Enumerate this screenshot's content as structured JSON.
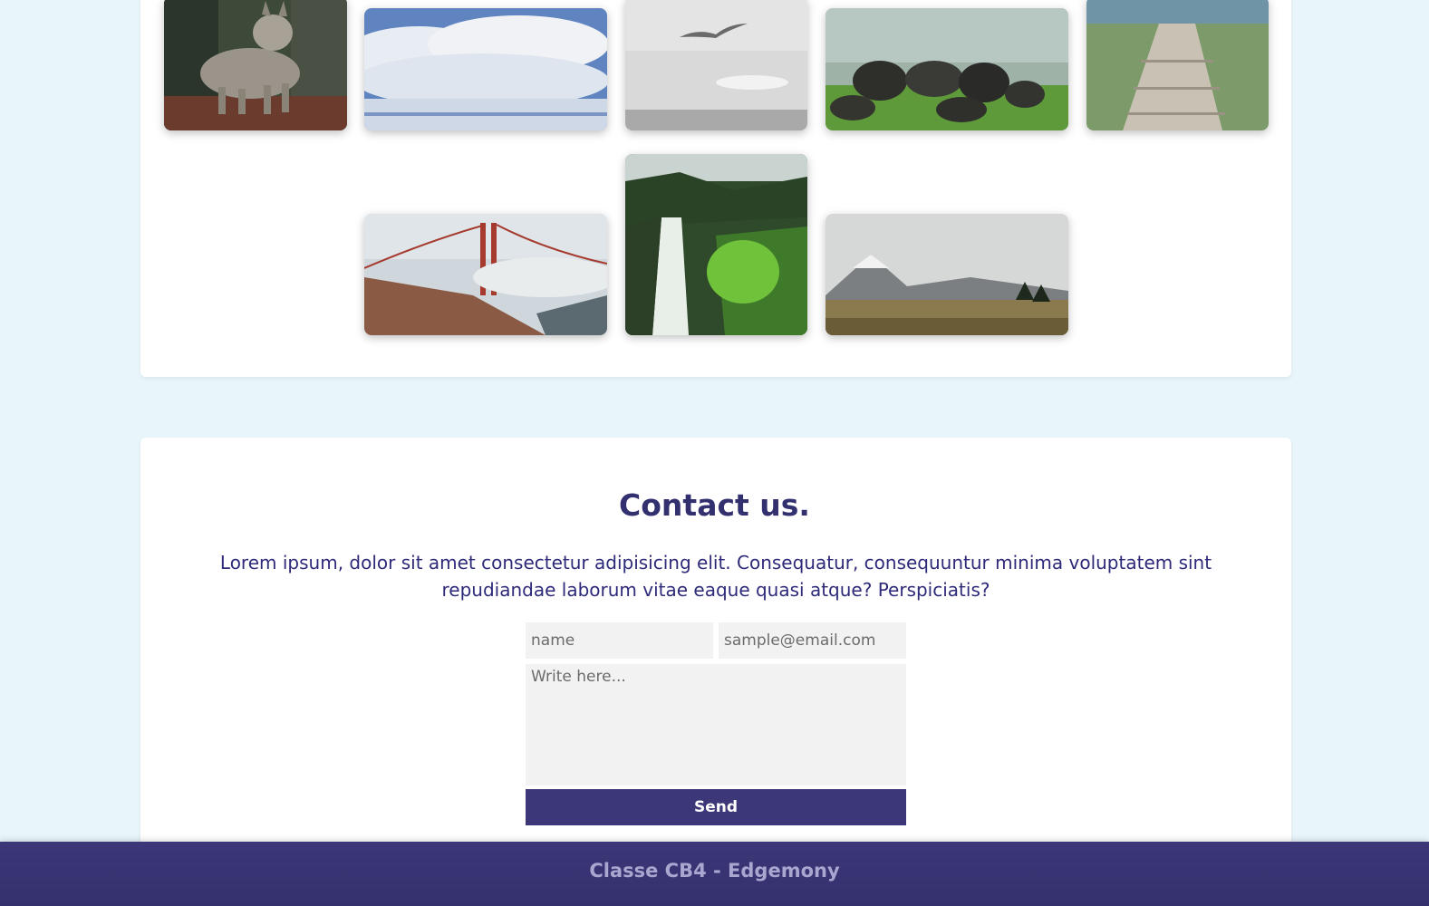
{
  "gallery": {
    "photos": [
      {
        "name": "wolf",
        "alt": "wolf"
      },
      {
        "name": "clouds",
        "alt": "clouds"
      },
      {
        "name": "seagull",
        "alt": "seagull"
      },
      {
        "name": "rocks",
        "alt": "rocks"
      },
      {
        "name": "boardwalk",
        "alt": "boardwalk"
      },
      {
        "name": "golden-gate-bridge",
        "alt": "golden-gate-bridge"
      },
      {
        "name": "waterfall",
        "alt": "waterfall"
      },
      {
        "name": "mountain-valley",
        "alt": "mountain-valley"
      }
    ]
  },
  "contact": {
    "title": "Contact us.",
    "description": "Lorem ipsum, dolor sit amet consectetur adipisicing elit. Consequatur, consequuntur minima voluptatem sint repudiandae laborum vitae eaque quasi atque? Perspiciatis?",
    "name_placeholder": "name",
    "email_placeholder": "sample@email.com",
    "message_placeholder": "Write here...",
    "send_label": "Send"
  },
  "footer": {
    "text": "Classe CB4 - Edgemony"
  },
  "colors": {
    "background": "#e8f6fb",
    "accent": "#3b3778",
    "title": "#333070",
    "footer_text": "#a9a6cf"
  }
}
